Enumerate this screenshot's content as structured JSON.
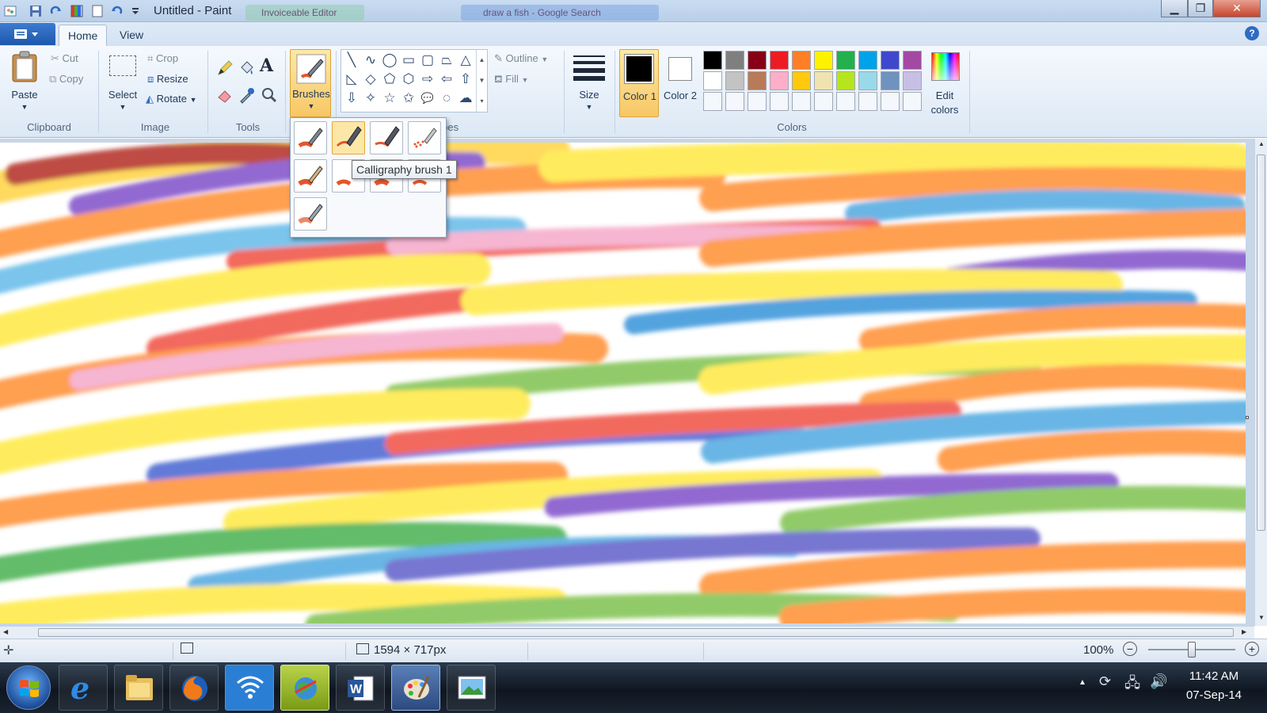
{
  "window": {
    "title": "Untitled - Paint",
    "background_tabs": [
      "Invoiceable Editor",
      "draw a fish - Google Search"
    ]
  },
  "ribbon_tabs": [
    {
      "label": "Home",
      "active": true
    },
    {
      "label": "View",
      "active": false
    }
  ],
  "clipboard": {
    "paste_label": "Paste",
    "cut_label": "Cut",
    "copy_label": "Copy",
    "group_label": "Clipboard"
  },
  "image": {
    "select_label": "Select",
    "crop_label": "Crop",
    "resize_label": "Resize",
    "rotate_label": "Rotate",
    "group_label": "Image"
  },
  "tools": {
    "group_label": "Tools",
    "text_tool_glyph": "A"
  },
  "brushes": {
    "label": "Brushes",
    "selected_index": 1,
    "tooltip": "Calligraphy brush 1",
    "items": [
      "Brush",
      "Calligraphy brush 1",
      "Calligraphy brush 2",
      "Airbrush",
      "Oil brush",
      "Crayon",
      "Marker",
      "Natural pencil",
      "Watercolor brush"
    ]
  },
  "shapes": {
    "group_label_partial": "apes",
    "outline_label": "Outline",
    "fill_label": "Fill",
    "glyphs": [
      "╲",
      "∿",
      "◯",
      "▭",
      "▢",
      "⏢",
      "△",
      "◺",
      "◇",
      "⬠",
      "⬡",
      "⇨",
      "⇦",
      "⇧",
      "⇩",
      "✧",
      "☆",
      "✩",
      "💬",
      "◌",
      "☁"
    ]
  },
  "size": {
    "label": "Size"
  },
  "colors": {
    "color1_label": "Color 1",
    "color2_label": "Color 2",
    "color1_value": "#000000",
    "color2_value": "#ffffff",
    "edit_label": "Edit colors",
    "group_label": "Colors",
    "palette_row1": [
      "#000000",
      "#7f7f7f",
      "#880015",
      "#ed1c24",
      "#ff7f27",
      "#fff200",
      "#22b14c",
      "#00a2e8",
      "#3f48cc",
      "#a349a4"
    ],
    "palette_row2": [
      "#ffffff",
      "#c3c3c3",
      "#b97a57",
      "#ffaec9",
      "#ffc90e",
      "#efe4b0",
      "#b5e61d",
      "#99d9ea",
      "#7092be",
      "#c8bfe7"
    ]
  },
  "status": {
    "dimensions": "1594 × 717px",
    "zoom": "100%",
    "zoom_fraction": 0.5
  },
  "taskbar": {
    "time": "11:42 AM",
    "date": "07-Sep-14"
  },
  "accent": {
    "ribbon_blue": "#1e57ad",
    "hover_orange": "#fde7a8"
  }
}
